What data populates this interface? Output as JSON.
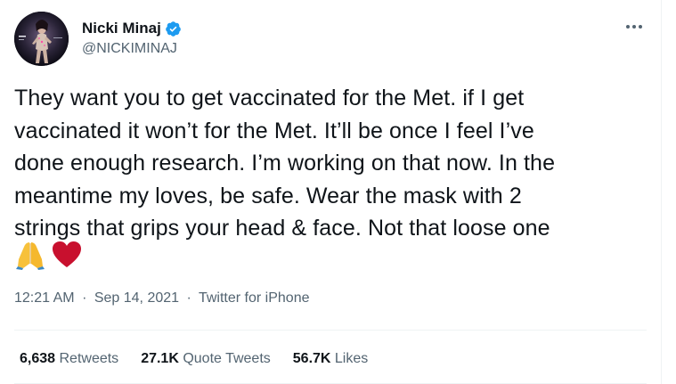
{
  "author": {
    "display_name": "Nicki Minaj",
    "handle": "@NICKIMINAJ",
    "verified": true,
    "avatar_icon": "profile-photo"
  },
  "tweet": {
    "lines": [
      "They want you to get vaccinated for the Met. if I get",
      "vaccinated it won’t for the Met. It’ll be once I feel I’ve",
      "done enough research. I’m working on that now. In the",
      "meantime my loves, be safe. Wear the mask with 2",
      "strings that grips your head & face. Not that loose one"
    ],
    "emojis": [
      "🙏",
      "❤"
    ]
  },
  "meta": {
    "time": "12:21 AM",
    "separator": "·",
    "date": "Sep 14, 2021",
    "source": "Twitter for iPhone"
  },
  "stats": {
    "retweets_count": "6,638",
    "retweets_label": "Retweets",
    "quotes_count": "27.1K",
    "quotes_label": "Quote Tweets",
    "likes_count": "56.7K",
    "likes_label": "Likes"
  },
  "colors": {
    "text_primary": "#0f1419",
    "text_secondary": "#536471",
    "verified_blue": "#1d9bf0",
    "divider": "#eff3f4",
    "heart_red": "#c8102e",
    "pray_yellow": "#f7c13b"
  },
  "icons": {
    "more": "more-options-icon",
    "verified": "verified-badge-icon"
  }
}
